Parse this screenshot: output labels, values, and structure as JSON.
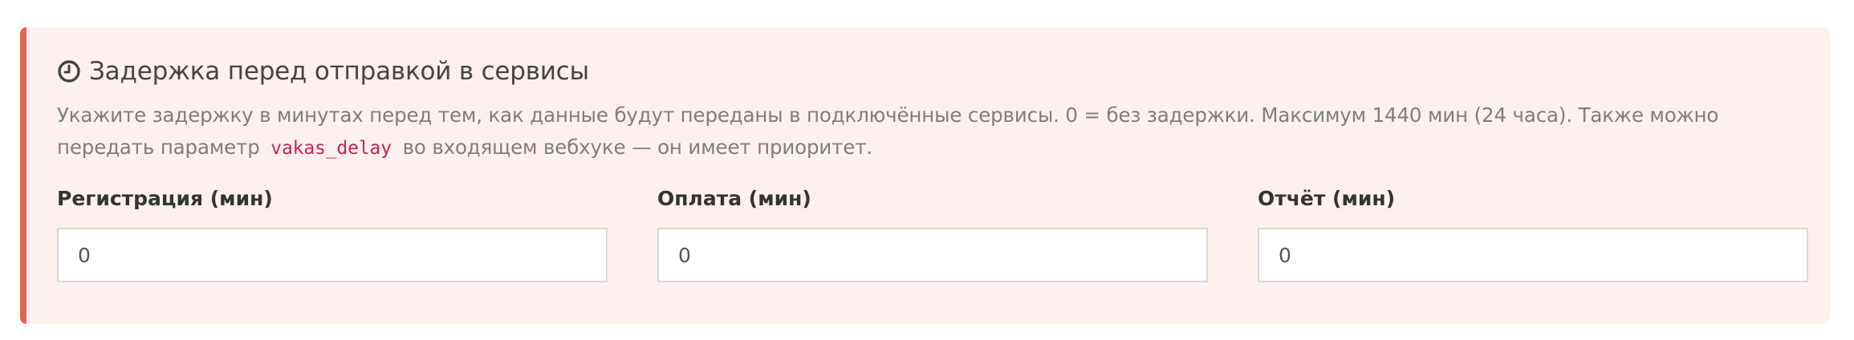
{
  "panel": {
    "title": "Задержка перед отправкой в сервисы",
    "icon": "clock-icon",
    "accent_color": "#e8604c",
    "background_color": "#fdf1ef",
    "description_before": "Укажите задержку в минутах перед тем, как данные будут переданы в подключённые сервисы. 0 = без задержки. Максимум 1440 мин (24 часа). Также можно передать параметр",
    "description_code": "vakas_delay",
    "description_after": "во входящем вебхуке — он имеет приоритет."
  },
  "fields": [
    {
      "label": "Регистрация (мин)",
      "value": "0"
    },
    {
      "label": "Оплата (мин)",
      "value": "0"
    },
    {
      "label": "Отчёт (мин)",
      "value": "0"
    }
  ]
}
